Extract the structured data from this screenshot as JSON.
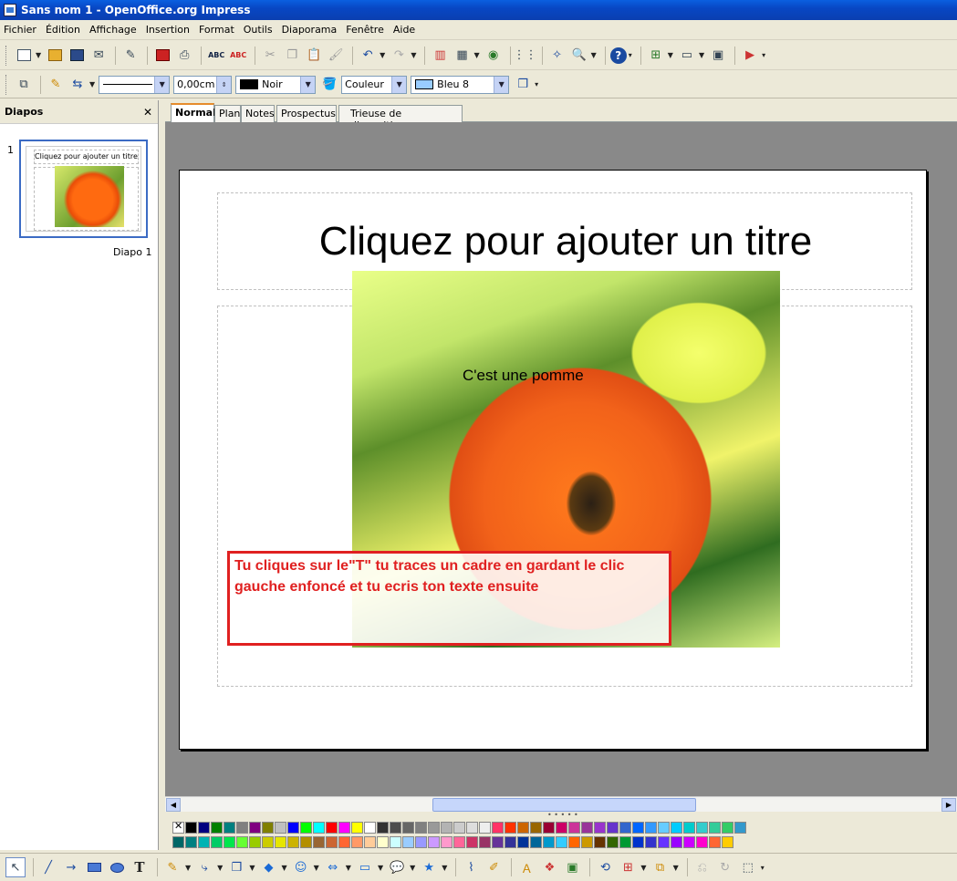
{
  "window": {
    "title": "Sans nom 1 - OpenOffice.org Impress"
  },
  "menu": [
    "Fichier",
    "Édition",
    "Affichage",
    "Insertion",
    "Format",
    "Outils",
    "Diaporama",
    "Fenêtre",
    "Aide"
  ],
  "line_toolbar": {
    "line_width": "0,00cm",
    "line_color": "Noir",
    "fill_type": "Couleur",
    "fill_color": "Bleu 8"
  },
  "slides_panel": {
    "title": "Diapos",
    "close": "✕",
    "slides": [
      {
        "number": "1",
        "name": "Diapo 1",
        "thumb_title": "Cliquez pour ajouter un titre"
      }
    ]
  },
  "view_tabs": [
    "Normal",
    "Plan",
    "Notes",
    "Prospectus",
    "Trieuse de diapositives"
  ],
  "slide": {
    "title_placeholder": "Cliquez pour ajouter un titre",
    "image_caption": "C'est une pomme",
    "note_text": "Tu cliques sur le\"T\" tu traces un cadre en gardant le clic gauche enfoncé et tu ecris ton texte ensuite"
  },
  "palette": {
    "row1": [
      "#000000",
      "#000080",
      "#008000",
      "#008080",
      "#808080",
      "#800080",
      "#808000",
      "#c0c0c0",
      "#0000ff",
      "#00ff00",
      "#00ffff",
      "#ff0000",
      "#ff00ff",
      "#ffff00",
      "#ffffff",
      "#333333",
      "#4d4d4d",
      "#666666",
      "#808080",
      "#999999",
      "#b3b3b3",
      "#cccccc",
      "#dddddd",
      "#eeeeee",
      "#ff3366",
      "#ff3300",
      "#cc6600",
      "#996600",
      "#990033",
      "#cc0066",
      "#cc3399",
      "#993399",
      "#9933cc",
      "#6633cc",
      "#3366cc",
      "#0066ff",
      "#3399ff",
      "#66ccff",
      "#00ccff",
      "#00cccc",
      "#33cccc",
      "#33cc99",
      "#33cc66",
      "#3399cc"
    ],
    "row2": [
      "#006666",
      "#008080",
      "#00b3b3",
      "#00cc66",
      "#00e64d",
      "#66ff33",
      "#99cc00",
      "#cccc00",
      "#e6e600",
      "#ccb300",
      "#b38f00",
      "#996633",
      "#cc6633",
      "#ff6633",
      "#ff9966",
      "#ffcc99",
      "#ffffcc",
      "#ccffff",
      "#99ccff",
      "#9999ff",
      "#cc99ff",
      "#ff99cc",
      "#ff6699",
      "#cc3366",
      "#993366",
      "#663399",
      "#333399",
      "#003399",
      "#006699",
      "#0099cc",
      "#33ccff",
      "#ff6600",
      "#cc9900",
      "#663300",
      "#336600",
      "#009933",
      "#0033cc",
      "#3333cc",
      "#6633ff",
      "#9900ff",
      "#cc00ff",
      "#ff00cc",
      "#ff6633",
      "#ffcc00"
    ]
  }
}
